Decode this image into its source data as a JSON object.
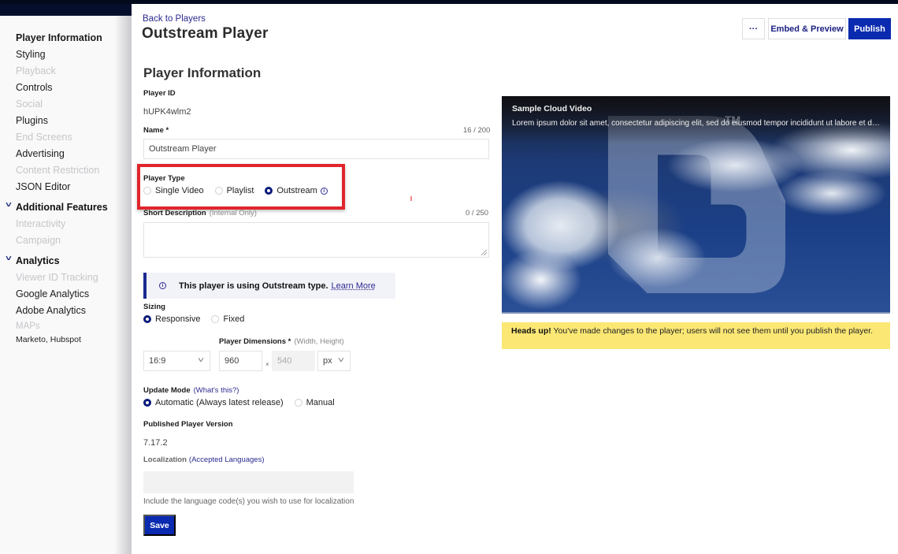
{
  "sidebar": {
    "items": [
      {
        "label": "Player Information",
        "state": "active"
      },
      {
        "label": "Styling",
        "state": "enabled"
      },
      {
        "label": "Playback",
        "state": "disabled"
      },
      {
        "label": "Controls",
        "state": "enabled"
      },
      {
        "label": "Social",
        "state": "disabled"
      },
      {
        "label": "Plugins",
        "state": "enabled"
      },
      {
        "label": "End Screens",
        "state": "disabled"
      },
      {
        "label": "Advertising",
        "state": "enabled"
      },
      {
        "label": "Content Restriction",
        "state": "disabled"
      },
      {
        "label": "JSON Editor",
        "state": "enabled"
      }
    ],
    "additional_features": {
      "label": "Additional Features",
      "items": [
        {
          "label": "Interactivity",
          "state": "disabled"
        },
        {
          "label": "Campaign",
          "state": "disabled"
        }
      ]
    },
    "analytics": {
      "label": "Analytics",
      "items": [
        {
          "label": "Viewer ID Tracking",
          "state": "disabled"
        },
        {
          "label": "Google Analytics",
          "state": "enabled"
        },
        {
          "label": "Adobe Analytics",
          "state": "enabled"
        },
        {
          "label": "MAPs",
          "state": "disabled",
          "sublabel": "Marketo, Hubspot"
        }
      ]
    },
    "chevron_icon": "chevron-down-icon"
  },
  "header": {
    "back_link": "Back to Players",
    "title": "Outstream Player",
    "more_label": "···",
    "embed_label": "Embed & Preview",
    "publish_label": "Publish"
  },
  "form": {
    "section_title": "Player Information",
    "player_id": {
      "label": "Player ID",
      "value": "hUPK4wlm2"
    },
    "name": {
      "label": "Name *",
      "value": "Outstream Player",
      "counter": "16 / 200"
    },
    "player_type": {
      "label": "Player Type",
      "options": [
        "Single Video",
        "Playlist",
        "Outstream"
      ],
      "selected": "Outstream",
      "info_icon": "info-circle-icon"
    },
    "short_description": {
      "label": "Short Description",
      "hint": "(Internal Only)",
      "value": "",
      "counter": "0 / 250"
    },
    "notice": {
      "text": "This player is using Outstream type.",
      "link": "Learn More",
      "icon": "info-circle-icon"
    },
    "sizing": {
      "label": "Sizing",
      "options": [
        "Responsive",
        "Fixed"
      ],
      "selected": "Responsive"
    },
    "dimensions": {
      "label": "Player Dimensions *",
      "hint": "(Width, Height)",
      "aspect_ratio": "16:9",
      "width": "960",
      "separator": "×",
      "height": "540",
      "unit": "px"
    },
    "update_mode": {
      "label": "Update Mode",
      "link": "(What's this?)",
      "options": [
        "Automatic (Always latest release)",
        "Manual"
      ],
      "selected": "Automatic (Always latest release)"
    },
    "published_version": {
      "label": "Published Player Version",
      "value": "7.17.2"
    },
    "localization": {
      "label": "Localization",
      "link": "(Accepted Languages)",
      "value": "",
      "help": "Include the language code(s) you wish to use for localization"
    },
    "save_label": "Save"
  },
  "preview": {
    "video_title": "Sample Cloud Video",
    "video_description": "Lorem ipsum dolor sit amet, consectetur adipiscing elit, sed do eiusmod tempor incididunt ut labore et dolore magna aliqua.",
    "trademark": "TM",
    "logo_icon": "brand-b-logo-icon"
  },
  "alert": {
    "strong": "Heads up!",
    "text": " You've made changes to the player; users will not see them until you publish the player.",
    "color": "#fbe774"
  },
  "colors": {
    "primary": "#0a2ab0",
    "link": "#2b2a8f",
    "highlight": "#e0262c"
  }
}
